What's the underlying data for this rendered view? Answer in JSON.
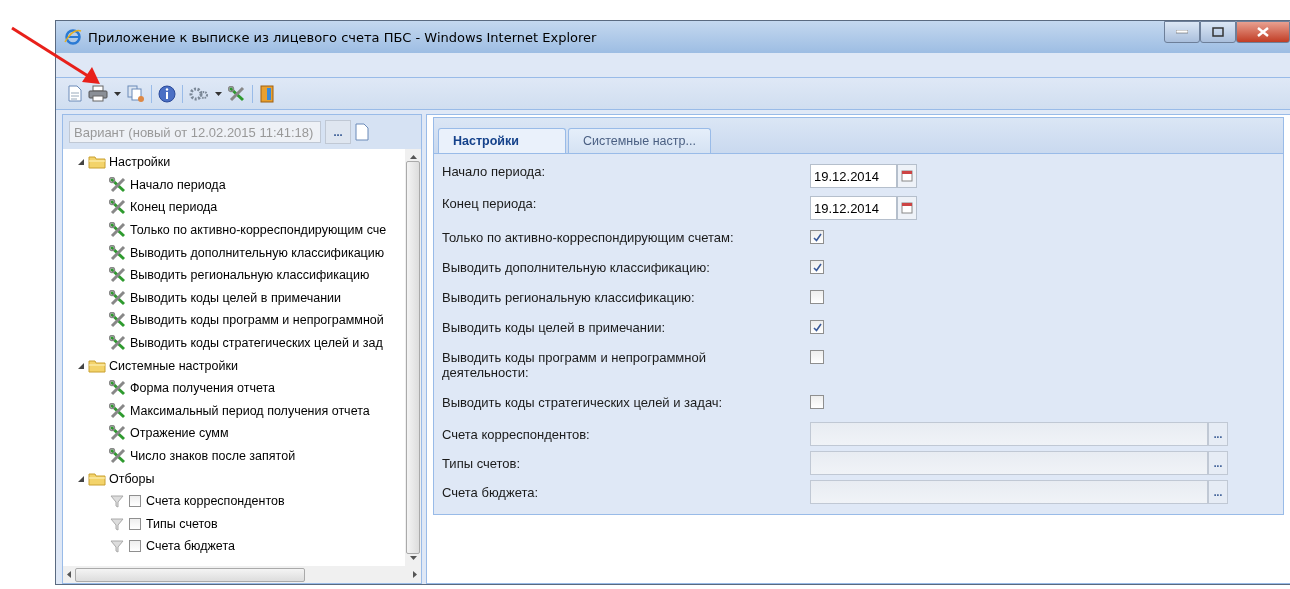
{
  "window": {
    "title": "Приложение к выписке из лицевого счета ПБС - Windows Internet Explorer"
  },
  "variant": {
    "value": "Вариант (новый от 12.02.2015 11:41:18)",
    "button": "..."
  },
  "tree": [
    {
      "label": "Настройки",
      "expanded": true,
      "children": [
        {
          "label": "Начало периода",
          "kind": "setting"
        },
        {
          "label": "Конец периода",
          "kind": "setting"
        },
        {
          "label": "Только по активно-корреспондирующим сче",
          "kind": "setting"
        },
        {
          "label": "Выводить дополнительную классификацию",
          "kind": "setting"
        },
        {
          "label": "Выводить региональную классификацию",
          "kind": "setting"
        },
        {
          "label": "Выводить коды целей в примечании",
          "kind": "setting"
        },
        {
          "label": "Выводить коды программ и непрограммной",
          "kind": "setting"
        },
        {
          "label": "Выводить коды стратегических целей и зад",
          "kind": "setting"
        }
      ]
    },
    {
      "label": "Системные настройки",
      "expanded": true,
      "children": [
        {
          "label": "Форма получения отчета",
          "kind": "setting"
        },
        {
          "label": "Максимальный период получения отчета",
          "kind": "setting"
        },
        {
          "label": "Отражение сумм",
          "kind": "setting"
        },
        {
          "label": "Число знаков после запятой",
          "kind": "setting"
        }
      ]
    },
    {
      "label": "Отборы",
      "expanded": true,
      "children": [
        {
          "label": "Счета корреспондентов",
          "kind": "filter",
          "checked": false
        },
        {
          "label": "Типы счетов",
          "kind": "filter",
          "checked": false
        },
        {
          "label": "Счета бюджета",
          "kind": "filter",
          "checked": false
        }
      ]
    }
  ],
  "tabs": [
    {
      "label": "Настройки",
      "selected": true
    },
    {
      "label": "Системные настр...",
      "selected": false
    }
  ],
  "form": [
    {
      "kind": "date",
      "label": "Начало периода:",
      "value": "19.12.2014"
    },
    {
      "kind": "date",
      "label": "Конец периода:",
      "value": "19.12.2014"
    },
    {
      "kind": "checkbox",
      "label": "Только по активно-корреспондирующим счетам:",
      "checked": true
    },
    {
      "kind": "checkbox",
      "label": "Выводить дополнительную классификацию:",
      "checked": true
    },
    {
      "kind": "checkbox",
      "label": "Выводить региональную классификацию:",
      "checked": false
    },
    {
      "kind": "checkbox",
      "label": "Выводить коды целей в примечании:",
      "checked": true
    },
    {
      "kind": "checkbox",
      "label": "Выводить коды программ и непрограммной деятельности:",
      "checked": false
    },
    {
      "kind": "checkbox",
      "label": "Выводить коды стратегических целей и задач:",
      "checked": false
    },
    {
      "kind": "lookup",
      "label": "Счета корреспондентов:",
      "button": "..."
    },
    {
      "kind": "lookup",
      "label": "Типы счетов:",
      "button": "..."
    },
    {
      "kind": "lookup",
      "label": "Счета бюджета:",
      "button": "..."
    }
  ]
}
